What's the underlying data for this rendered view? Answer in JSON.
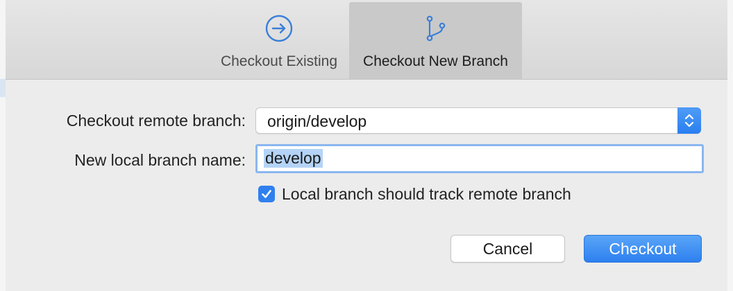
{
  "tabs": [
    {
      "label": "Checkout Existing",
      "icon": "arrow-circle-right-icon",
      "active": false
    },
    {
      "label": "Checkout New Branch",
      "icon": "git-branch-icon",
      "active": true
    }
  ],
  "form": {
    "remote_label": "Checkout remote branch:",
    "remote_value": "origin/develop",
    "local_label": "New local branch name:",
    "local_value": "develop",
    "track_label": "Local branch should track remote branch",
    "track_checked": true
  },
  "buttons": {
    "cancel": "Cancel",
    "checkout": "Checkout"
  },
  "colors": {
    "accent": "#2f80ee",
    "icon_blue": "#3a7fd8",
    "selection": "#b4d3f6"
  }
}
